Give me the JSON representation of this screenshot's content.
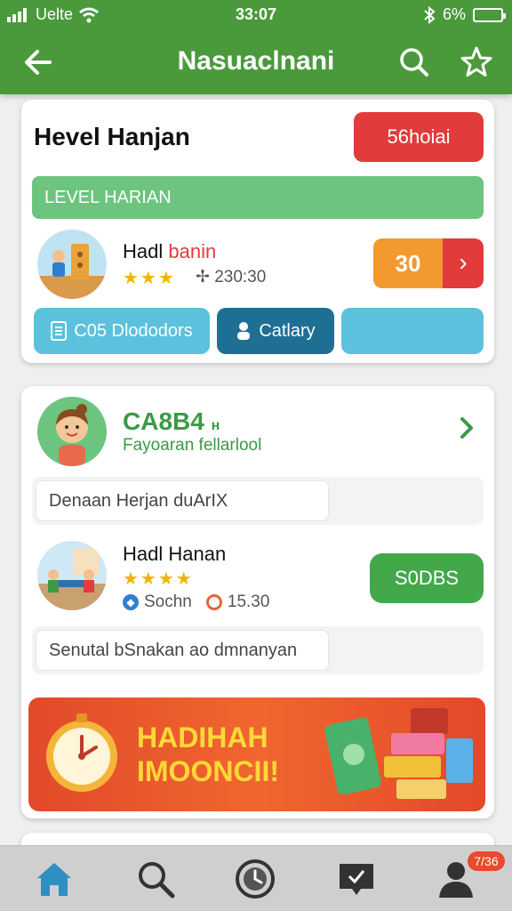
{
  "status_bar": {
    "carrier": "Uelte",
    "time": "33:07",
    "battery": "6%"
  },
  "app_bar": {
    "title": "Nasuaclnani"
  },
  "card1": {
    "title": "Hevel Hanjan",
    "badge": "56hoiai",
    "banner": "LEVEL HARIAN",
    "name_part1": "Hadl ",
    "name_part2": "banin",
    "stars": "★★★",
    "meta": "✢ 230:30",
    "score": "30",
    "btn1": "C05 Dlododors",
    "btn2": "Catlary",
    "btn3": ""
  },
  "card2": {
    "name": "CA8B4",
    "name_suffix": "н",
    "subtitle": "Fayoaran fellarlool",
    "field1": "Denaan Herjan duArIX",
    "name2": "Hadl Hanan",
    "stars2": "★★★★",
    "meta2_a": "Sochn",
    "meta2_b": "15.30",
    "score2": "S0DBS",
    "field2": "Senutal bSnakan ao dmnanyan"
  },
  "promo": {
    "line1": "HADIHAH",
    "line2": "IMOONCII!"
  },
  "bottom_nav": {
    "badge": "7/36"
  },
  "colors": {
    "primary": "#4a9a3c",
    "accent_red": "#e23b3b",
    "accent_orange": "#f29a2e",
    "teal": "#5bc1dc",
    "dark_teal": "#1f6f94"
  }
}
